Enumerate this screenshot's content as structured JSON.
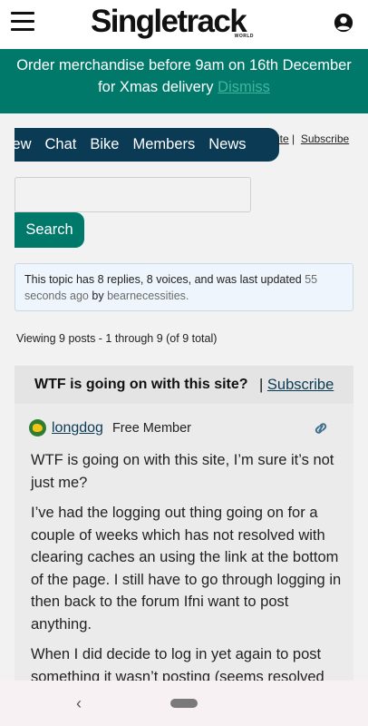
{
  "header": {
    "logo_text": "Singletrack",
    "logo_subtext": "WORLD"
  },
  "banner": {
    "message_line1": "Order merchandise before 9am on 16th December",
    "message_line2": "for Xmas delivery",
    "dismiss_label": "Dismiss"
  },
  "forum_nav": {
    "tabs": [
      "rview",
      "Chat",
      "Bike",
      "Members",
      "News"
    ],
    "sub_links": [
      "ite",
      "Subscribe"
    ]
  },
  "search": {
    "placeholder": "",
    "button_label": "Search"
  },
  "notice": {
    "text_main": "This topic has 8 replies, 8 voices, and was last updated",
    "time_ago": "55 seconds ago",
    "by": "by",
    "user": "bearnecessities."
  },
  "viewing": "Viewing 9 posts - 1 through 9 (of 9 total)",
  "topic": {
    "title": "WTF is going on with this site?",
    "separator": "|",
    "subscribe_label": "Subscribe"
  },
  "post": {
    "author": "longdog",
    "role": "Free Member",
    "paragraphs": [
      "WTF is going on with this site, I’m sure it’s not just me?",
      "I’ve had the logging out thing going on for a couple of weeks which has not resolved with clearing caches an using the link at the bottom of the page. I still have to go through logging in then back to the forum Ifni want to post anything.",
      "When I did decide to log in yet again to post something it wasn’t posting (seems resolved"
    ]
  },
  "system_nav": {
    "back_glyph": "‹"
  },
  "colors": {
    "brand_teal": "#00796b",
    "nav_navy": "#0b3a55",
    "notice_bg": "#eef5fc"
  },
  "icons": [
    "hamburger-menu-icon",
    "account-circle-icon",
    "permalink-icon",
    "back-icon",
    "home-pill-icon"
  ]
}
